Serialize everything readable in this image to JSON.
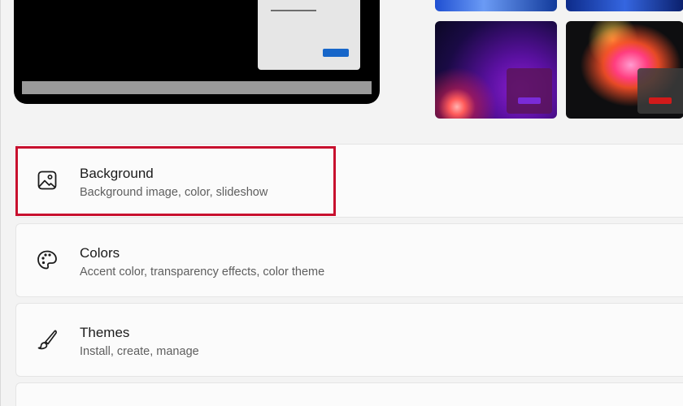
{
  "cards": [
    {
      "title": "Background",
      "subtitle": "Background image, color, slideshow",
      "icon": "image-icon"
    },
    {
      "title": "Colors",
      "subtitle": "Accent color, transparency effects, color theme",
      "icon": "palette-icon"
    },
    {
      "title": "Themes",
      "subtitle": "Install, create, manage",
      "icon": "brush-icon"
    }
  ],
  "colors": {
    "highlight": "#c8102e",
    "accent": "#1766c9"
  }
}
